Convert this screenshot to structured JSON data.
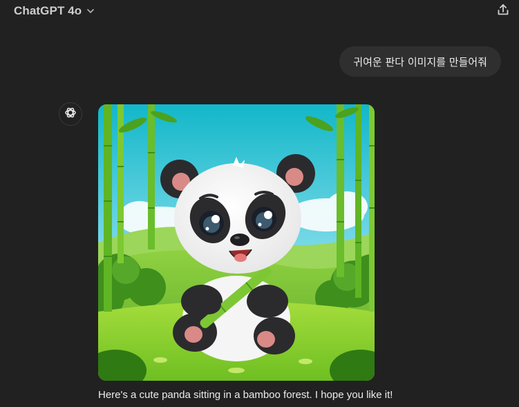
{
  "header": {
    "model_name": "ChatGPT 4o",
    "chevron_icon": "chevron-down-icon",
    "share_icon": "share-upload-icon"
  },
  "conversation": {
    "user_message": "귀여운 판다 이미지를 만들어줘",
    "assistant": {
      "avatar_icon": "openai-logo-icon",
      "image_subject": "cartoon panda holding bamboo in a bamboo forest",
      "text": "Here's a cute panda sitting in a bamboo forest. I hope you like it!"
    }
  },
  "colors": {
    "background": "#212121",
    "bubble": "#2f2f2f",
    "text": "#ececec"
  }
}
